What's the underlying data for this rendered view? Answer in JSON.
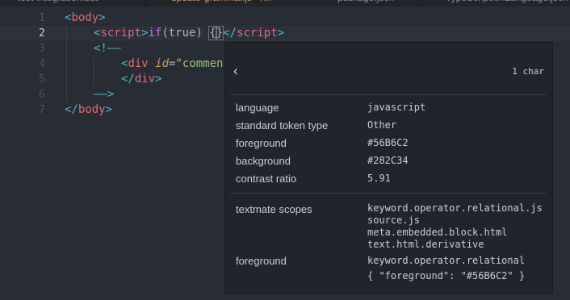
{
  "tabs": [
    {
      "label": "test-integration.bat"
    },
    {
      "label": "update-grammar.js • /..."
    },
    {
      "label": "package.json"
    },
    {
      "label": "TypeScript.tmLanguage.json"
    }
  ],
  "line_numbers": [
    "1",
    "2",
    "3",
    "4",
    "5",
    "6",
    "7"
  ],
  "current_line": "2",
  "code": {
    "l1": {
      "open": "<",
      "tag": "body",
      "close": ">"
    },
    "l2": {
      "open": "<",
      "tag": "script",
      "close": ">",
      "kw": "if",
      "paren_open": "(",
      "value": "true",
      "paren_close": ")",
      "space": " ",
      "brace_open": "{",
      "brace_close": "}",
      "end_open": "</",
      "end_tag": "script",
      "end_close": ">"
    },
    "l3": {
      "comment_open": "<!——"
    },
    "l4": {
      "open": "<",
      "tag": "div",
      "space": " ",
      "attr": "id",
      "eq": "=",
      "str": "\"commen"
    },
    "l5": {
      "end_open": "</",
      "tag": "div",
      "close": ">"
    },
    "l6": {
      "comment_close": "——>"
    },
    "l7": {
      "end_open": "</",
      "tag": "body",
      "close": ">"
    }
  },
  "inspector": {
    "back_glyph": "‹",
    "char_count": "1 char",
    "rows": [
      {
        "label": "language",
        "value": "javascript"
      },
      {
        "label": "standard token type",
        "value": "Other"
      },
      {
        "label": "foreground",
        "value": "#56B6C2"
      },
      {
        "label": "background",
        "value": "#282C34"
      },
      {
        "label": "contrast ratio",
        "value": "5.91"
      }
    ],
    "scopes_label": "textmate scopes",
    "scopes": [
      "keyword.operator.relational.js",
      "source.js",
      "meta.embedded.block.html",
      "text.html.derivative"
    ],
    "fg_rule_label": "foreground",
    "fg_rule_scope": "keyword.operator.relational",
    "fg_rule_value": "{ \"foreground\": \"#56B6C2\" }"
  },
  "colors": {
    "editor_bg": "#282c34",
    "tag": "#e06c75",
    "punctuation": "#56b6c2",
    "keyword": "#c678dd"
  }
}
